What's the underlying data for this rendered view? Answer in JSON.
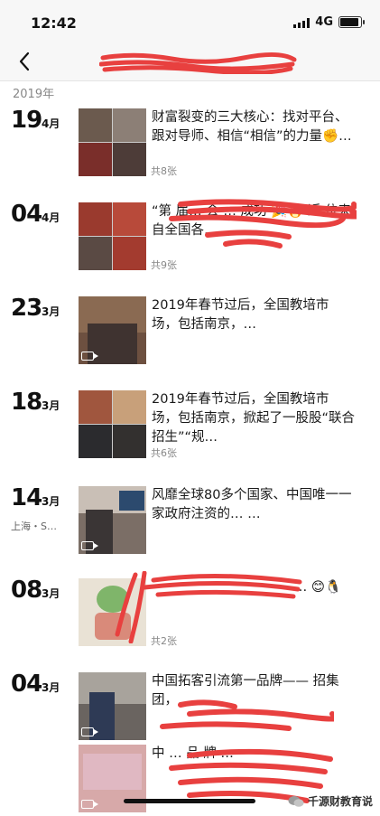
{
  "status_bar": {
    "time": "12:42",
    "network": "4G",
    "battery_level": 0.9
  },
  "nav": {
    "title": ""
  },
  "timeline": {
    "year": "2019年",
    "entries": [
      {
        "day": "19",
        "month": "4月",
        "location": "",
        "text": "财富裂变的三大核心：找对平台、跟对导师、相信“相信”的力量✊…",
        "count": "共8张"
      },
      {
        "day": "04",
        "month": "4月",
        "location": "",
        "text": "“第 届… 会 … 成功 🎉🔥 近 位来自全国各…",
        "count": "共9张"
      },
      {
        "day": "23",
        "month": "3月",
        "location": "",
        "text": "2019年春节过后，全国教培市场，包括南京，…",
        "count": ""
      },
      {
        "day": "18",
        "month": "3月",
        "location": "",
        "text": "2019年春节过后，全国教培市场，包括南京，掀起了一股股“联合招生”“规…",
        "count": "共6张"
      },
      {
        "day": "14",
        "month": "3月",
        "location": "上海・S…",
        "text": "风靡全球80多个国家、中国唯一一家政府注资的… …",
        "count": ""
      },
      {
        "day": "08",
        "month": "3月",
        "location": "",
        "text": "… 😊🐧",
        "count": "共2张"
      },
      {
        "day": "04",
        "month": "3月",
        "location": "",
        "text": "中国拓客引流第一品牌—— 招集团，…",
        "count": ""
      },
      {
        "day": "",
        "month": "",
        "location": "",
        "text": "中 … 品 牌 …",
        "count": ""
      }
    ]
  },
  "watermark": {
    "label": "千源财教育说"
  },
  "colors": {
    "redaction": "#e8403f",
    "accent": "#111111"
  }
}
